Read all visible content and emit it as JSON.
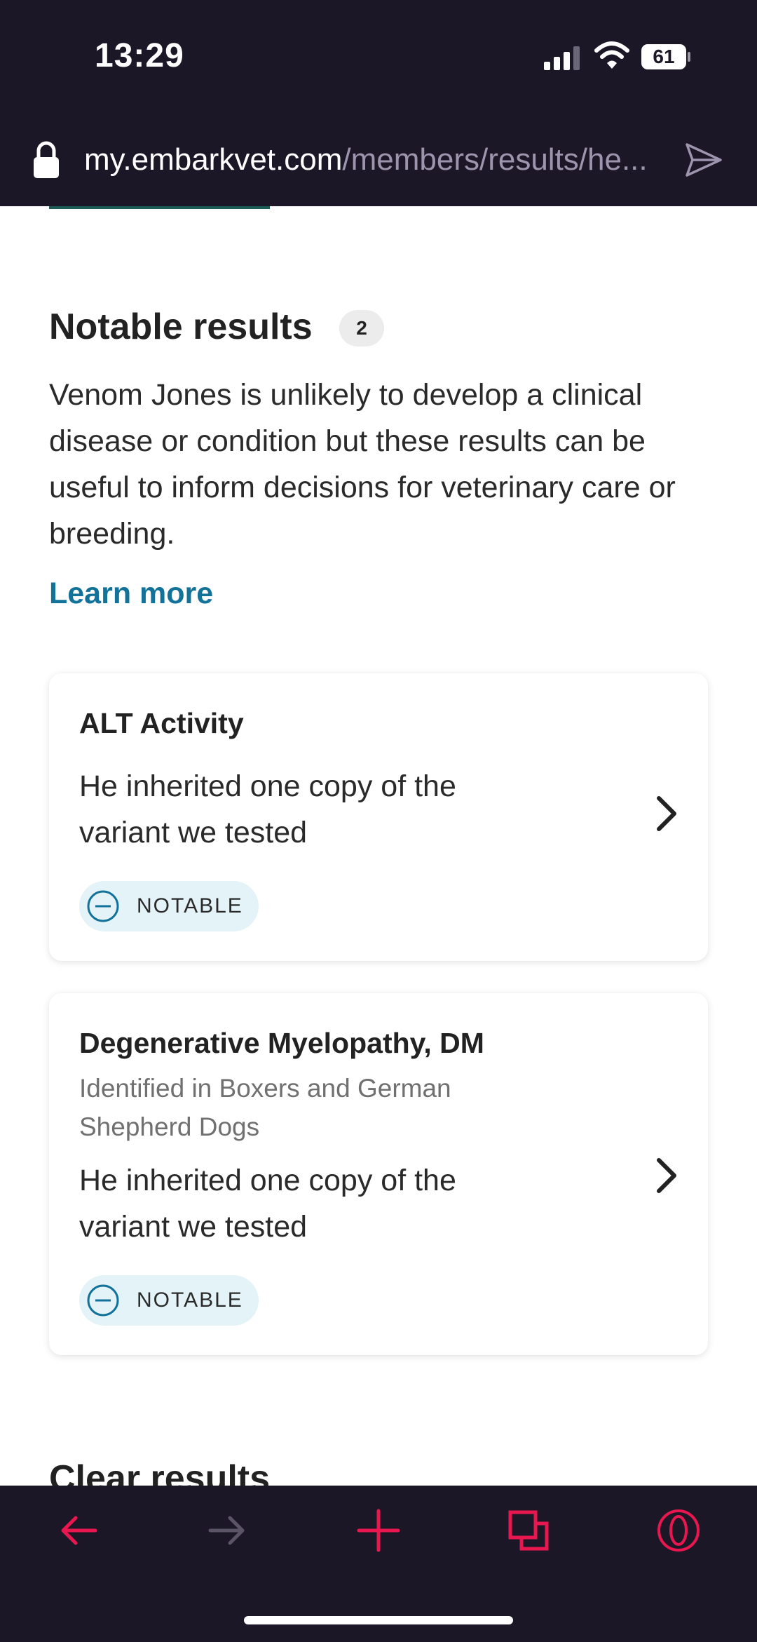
{
  "status_bar": {
    "time": "13:29",
    "battery": "61"
  },
  "browser": {
    "url_domain": "my.embarkvet.com",
    "url_path": "/members/results/he..."
  },
  "notable": {
    "title": "Notable results",
    "count": "2",
    "description": "Venom Jones is unlikely to develop a clinical disease or condition but these results can be useful to inform decisions for veterinary care or breeding.",
    "learn_more": "Learn more",
    "cards": [
      {
        "title": "ALT Activity",
        "subtitle": "",
        "body": "He inherited one copy of the variant we tested",
        "badge": "NOTABLE"
      },
      {
        "title": "Degenerative Myelopathy, DM",
        "subtitle": "Identified in Boxers and German Shepherd Dogs",
        "body": "He inherited one copy of the variant we tested",
        "badge": "NOTABLE"
      }
    ]
  },
  "next_section": {
    "title": "Clear results"
  },
  "colors": {
    "accent": "#12729a",
    "badge_bg": "#e4f3f8",
    "nav_icon": "#e8174f",
    "chrome": "#1c1726"
  },
  "icons": [
    "lock-icon",
    "send-icon",
    "back-icon",
    "forward-icon",
    "new-tab-icon",
    "tabs-icon",
    "opera-menu-icon",
    "chevron-right-icon",
    "notable-minus-icon"
  ]
}
